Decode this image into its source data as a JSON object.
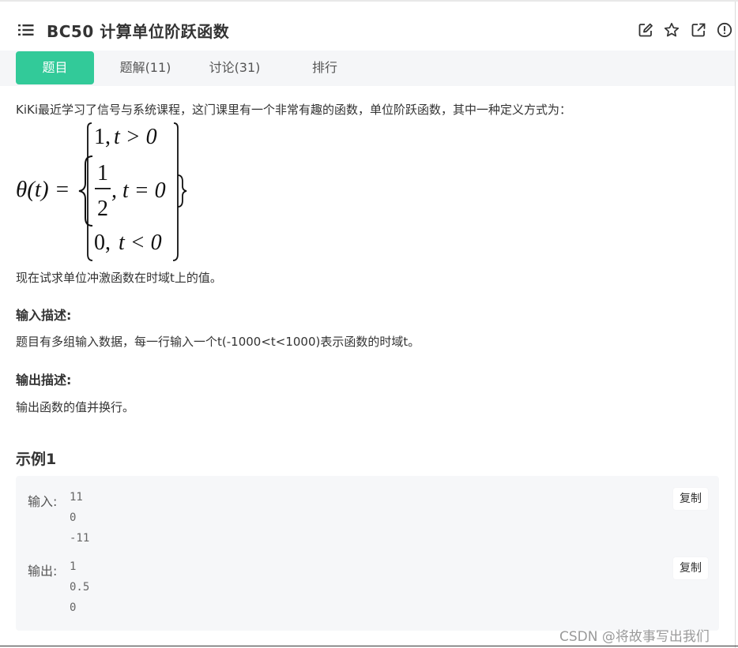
{
  "header": {
    "title": "BC50  计算单位阶跃函数",
    "icons": [
      "list-icon",
      "edit-icon",
      "star-icon",
      "share-icon",
      "info-icon"
    ]
  },
  "tabs": [
    {
      "label": "题目",
      "active": true
    },
    {
      "label": "题解(11)",
      "active": false
    },
    {
      "label": "讨论(31)",
      "active": false
    },
    {
      "label": "排行",
      "active": false
    }
  ],
  "description": {
    "intro": "KiKi最近学习了信号与系统课程，这门课里有一个非常有趣的函数，单位阶跃函数，其中一种定义方式为：",
    "task": "现在试求单位冲激函数在时域t上的值。"
  },
  "formula": {
    "lhs": "θ(t) =",
    "case1_value": "1,",
    "case1_cond": "t > 0",
    "case2_num": "1",
    "case2_den": "2",
    "case2_cond": ", t = 0",
    "case3_value": "0,",
    "case3_cond": "t < 0"
  },
  "input_section": {
    "title": "输入描述:",
    "text": "题目有多组输入数据，每一行输入一个t(-1000<t<1000)表示函数的时域t。"
  },
  "output_section": {
    "title": "输出描述:",
    "text": "输出函数的值并换行。"
  },
  "example": {
    "title": "示例1",
    "input_label": "输入:",
    "input_lines": [
      "11",
      "0",
      "-11"
    ],
    "output_label": "输出:",
    "output_lines": [
      "1",
      "0.5",
      "0"
    ],
    "copy_label": "复制"
  },
  "watermark": "CSDN @将故事写出我们"
}
